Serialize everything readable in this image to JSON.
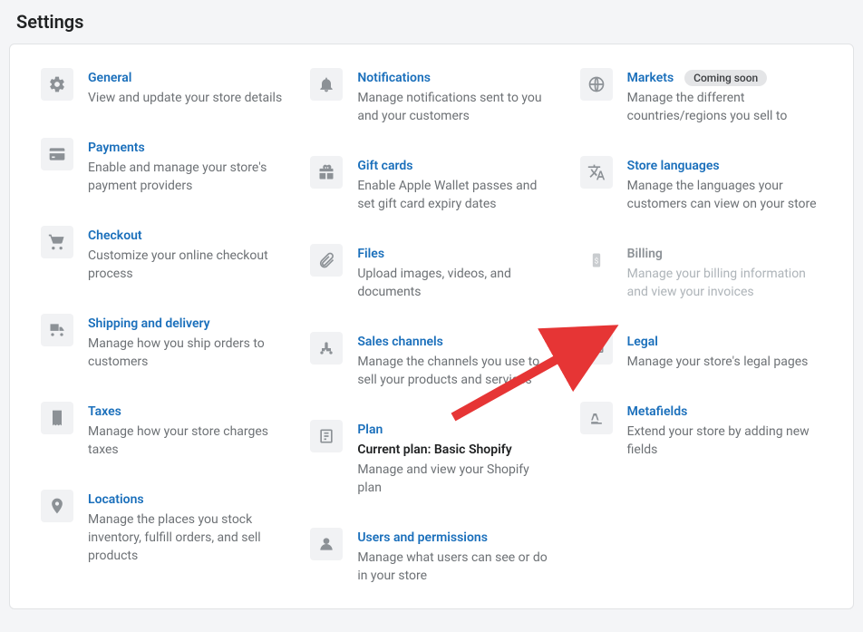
{
  "page_title": "Settings",
  "badges": {
    "coming_soon": "Coming soon"
  },
  "col1": [
    {
      "title": "General",
      "desc": "View and update your store details"
    },
    {
      "title": "Payments",
      "desc": "Enable and manage your store's payment providers"
    },
    {
      "title": "Checkout",
      "desc": "Customize your online checkout process"
    },
    {
      "title": "Shipping and delivery",
      "desc": "Manage how you ship orders to customers"
    },
    {
      "title": "Taxes",
      "desc": "Manage how your store charges taxes"
    },
    {
      "title": "Locations",
      "desc": "Manage the places you stock inventory, fulfill orders, and sell products"
    }
  ],
  "col2": [
    {
      "title": "Notifications",
      "desc": "Manage notifications sent to you and your customers"
    },
    {
      "title": "Gift cards",
      "desc": "Enable Apple Wallet passes and set gift card expiry dates"
    },
    {
      "title": "Files",
      "desc": "Upload images, videos, and documents"
    },
    {
      "title": "Sales channels",
      "desc": "Manage the channels you use to sell your products and services"
    },
    {
      "title": "Plan",
      "extra": "Current plan: Basic Shopify",
      "desc": "Manage and view your Shopify plan"
    },
    {
      "title": "Users and permissions",
      "desc": "Manage what users can see or do in your store"
    }
  ],
  "col3": [
    {
      "title": "Markets",
      "badge": "coming_soon",
      "desc": "Manage the different countries/regions you sell to"
    },
    {
      "title": "Store languages",
      "desc": "Manage the languages your customers can view on your store"
    },
    {
      "title": "Billing",
      "desc": "Manage your billing information and view your invoices",
      "disabled": true
    },
    {
      "title": "Legal",
      "desc": "Manage your store's legal pages"
    },
    {
      "title": "Metafields",
      "desc": "Extend your store by adding new fields"
    }
  ]
}
